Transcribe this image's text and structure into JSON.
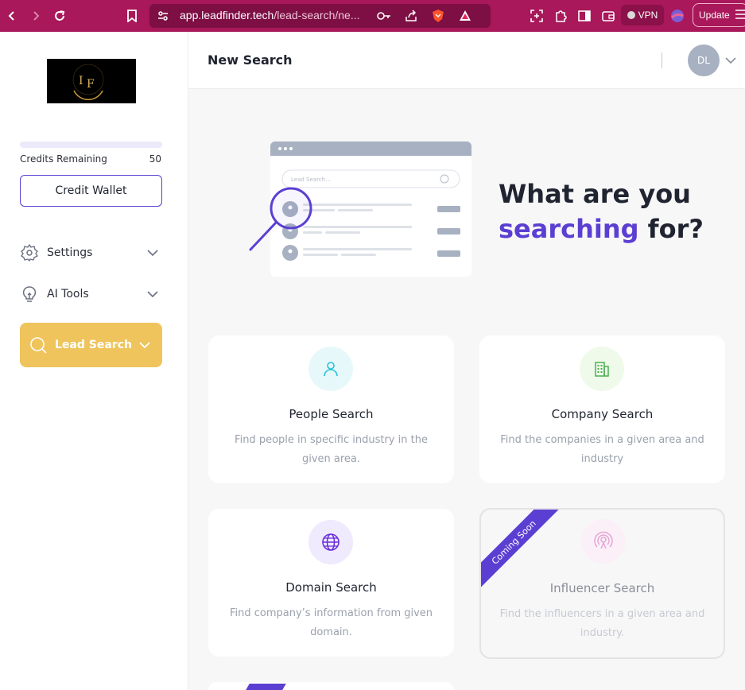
{
  "browser": {
    "url_host": "app.leadfinder.tech",
    "url_path": "/lead-search/ne...",
    "vpn_label": "VPN",
    "update_label": "Update"
  },
  "sidebar": {
    "credits_label": "Credits Remaining",
    "credits_value": "50",
    "credit_wallet_label": "Credit Wallet",
    "items": [
      {
        "label": "Settings",
        "icon": "gear-icon"
      },
      {
        "label": "AI Tools",
        "icon": "lightbulb-icon"
      }
    ],
    "active_item": {
      "label": "Lead Search",
      "icon": "search-icon"
    }
  },
  "header": {
    "title": "New Search",
    "avatar_initials": "DL"
  },
  "hero": {
    "line1": "What are you",
    "accent": "searching",
    "line2_rest": " for?",
    "illustration_search_placeholder": "Lead Search..."
  },
  "cards": [
    {
      "title": "People Search",
      "description": "Find people in specific industry in the given area.",
      "icon": "person-icon"
    },
    {
      "title": "Company Search",
      "description": "Find the companies in a given area and industry",
      "icon": "building-icon"
    },
    {
      "title": "Domain Search",
      "description": "Find company’s information from given domain.",
      "icon": "globe-icon"
    },
    {
      "title": "Influencer Search",
      "description": "Find the influencers in a given area and industry.",
      "icon": "broadcast-icon",
      "ribbon": "Coming Soon"
    }
  ],
  "colors": {
    "browser_bar": "#a8185a",
    "accent": "#5b3fd2",
    "lead_search_bg": "#efc45c"
  }
}
